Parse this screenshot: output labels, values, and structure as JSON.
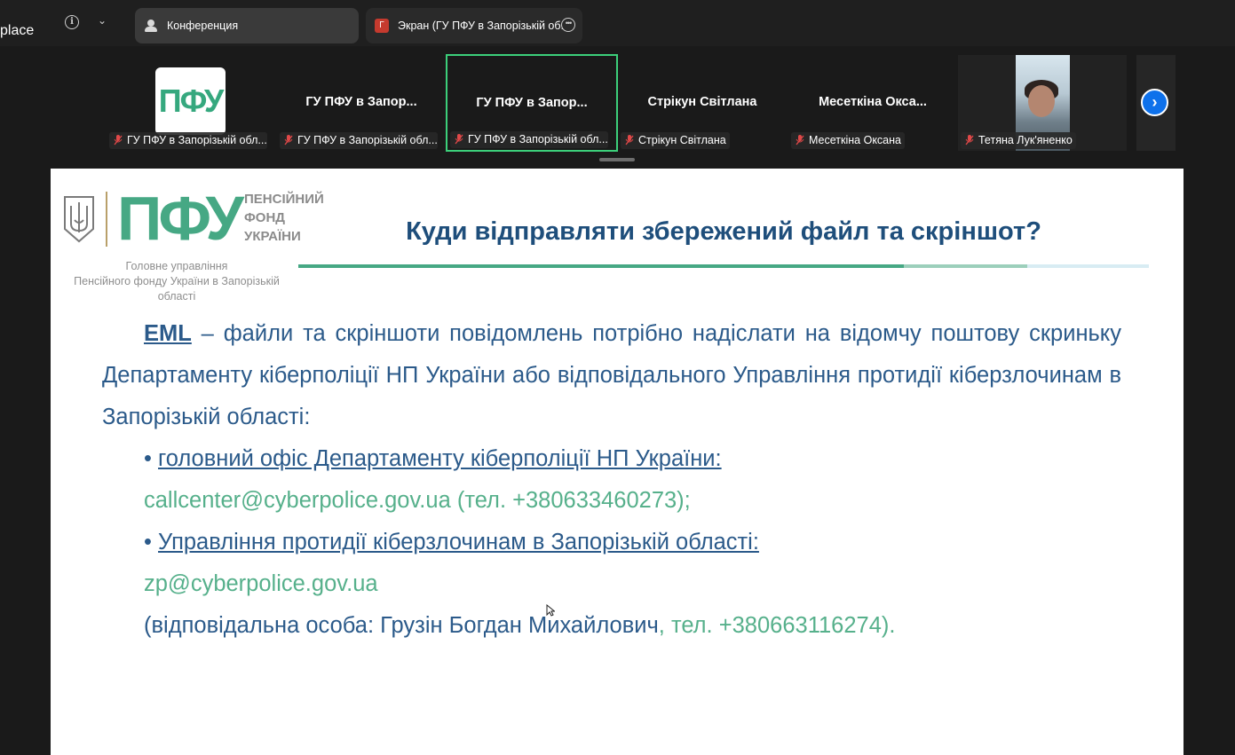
{
  "topbar": {
    "app_name": "place",
    "tabs": [
      {
        "label": "Конференция",
        "icon": "people-icon"
      },
      {
        "label": "Экран (ГУ ПФУ в Запорізькій об.",
        "badge": "Г",
        "icon": "screen-share-icon"
      }
    ]
  },
  "participants": [
    {
      "title": "",
      "label": "ГУ ПФУ в Запорізькій обл....",
      "logo": "ПФУ",
      "muted": true
    },
    {
      "title": "ГУ ПФУ в Запор...",
      "label": "ГУ ПФУ в Запорізькій обл...",
      "muted": true
    },
    {
      "title": "ГУ ПФУ в Запор...",
      "label": "ГУ ПФУ в Запорізькій обл...",
      "muted": true,
      "active": true
    },
    {
      "title": "Стрікун Світлана",
      "label": "Стрікун Світлана",
      "muted": true
    },
    {
      "title": "Месеткіна Окса...",
      "label": "Месеткіна Оксана",
      "muted": true
    },
    {
      "title": "",
      "label": "Тетяна Лук'яненко",
      "muted": true,
      "video": true
    }
  ],
  "slide": {
    "logo_text": "ПФУ",
    "logo_sub": [
      "ПЕНСІЙНИЙ",
      "ФОНД",
      "УКРАЇНИ"
    ],
    "logo_caption_1": "Головне управління",
    "logo_caption_2": "Пенсійного фонду України в Запорізькій області",
    "title": "Куди відправляти збережений файл та скріншот?",
    "intro_eml": "EML",
    "intro_text": " – файли та скріншоти повідомлень потрібно надіслати на відомчу поштову скриньку Департаменту кіберполіції НП України або відповідального Управління протидії кіберзлочинам в Запорізькій області:",
    "bullet_1": "головний офіс Департаменту кіберполіції НП України: ",
    "email_1": "callcenter@cyberpolice.gov.ua (тел. +380633460273);",
    "bullet_2": "Управління протидії кіберзлочинам в Запорізькій області:",
    "email_2": "zp@cyberpolice.gov.ua",
    "contact_person": "(відповідальна особа: Грузін Богдан Михайлович",
    "contact_phone": ", тел. +380663116274)."
  },
  "colors": {
    "accent_green": "#46a884",
    "title_blue": "#1e4e7b",
    "active_border": "#3ccf7a",
    "zoom_blue": "#0e71eb"
  }
}
